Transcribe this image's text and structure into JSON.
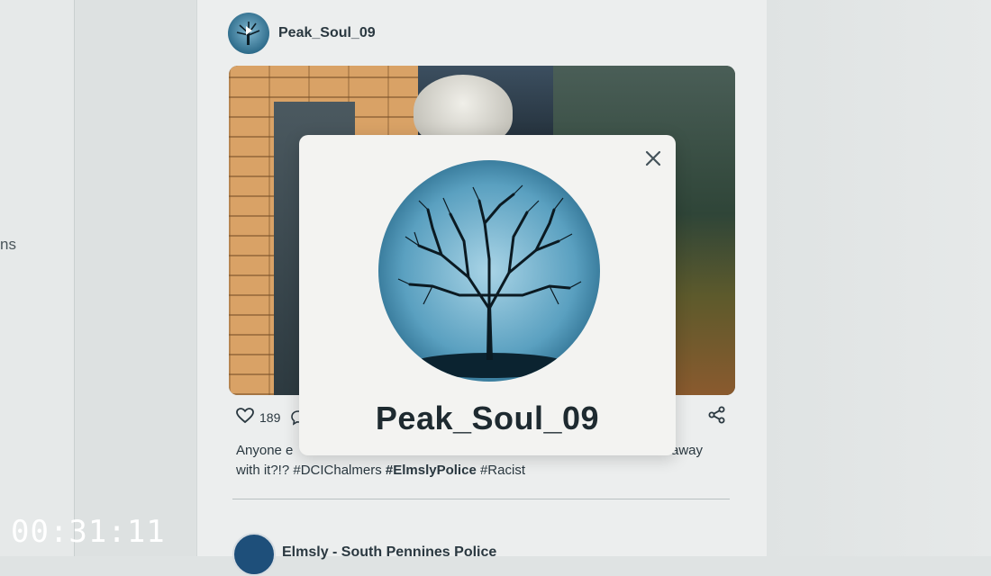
{
  "sidebar": {
    "fragment": "ns"
  },
  "post": {
    "author": "Peak_Soul_09",
    "likes": "189",
    "text_start": "Anyone e",
    "text_end": "away",
    "text_line2_prefix": "with it?!? #DCIChalmers ",
    "text_line2_bold": "#ElmslyPolice",
    "text_line2_suffix": " #Racist"
  },
  "next_post": {
    "author": "Elmsly - South Pennines Police"
  },
  "modal": {
    "name": "Peak_Soul_09"
  },
  "overlay": {
    "timecode": "00:31:11"
  },
  "icons": {
    "close": "close-icon",
    "heart": "heart-icon",
    "comment": "comment-icon",
    "share": "share-icon",
    "avatar": "tree-avatar"
  }
}
